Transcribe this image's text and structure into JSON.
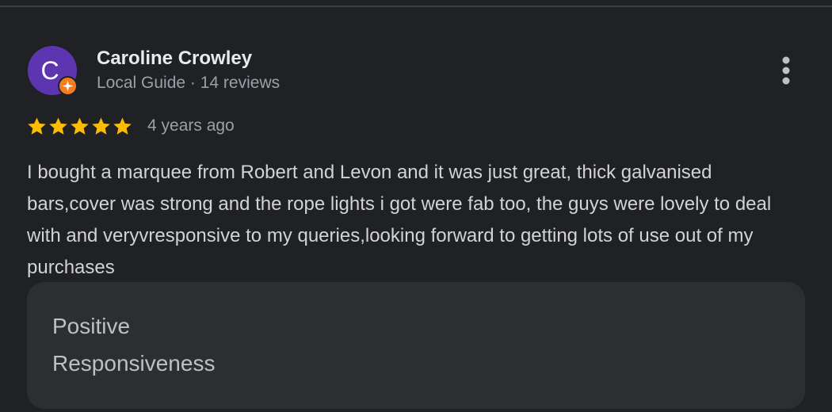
{
  "review": {
    "author": {
      "name": "Caroline Crowley",
      "initial": "C",
      "meta": "Local Guide · 14 reviews",
      "avatar_color": "#5e35b1",
      "badge_color": "#f57c1f",
      "badge_icon": "local-guide-star-icon"
    },
    "rating": {
      "stars": 5,
      "max": 5,
      "star_color": "#fbbc04"
    },
    "date": "4 years ago",
    "text": "I bought a marquee from Robert and Levon and it was just great, thick galvanised bars,cover was strong and the rope lights i got were fab too, the guys were lovely to deal with and veryvresponsive to my queries,looking forward to getting lots of use out of my purchases",
    "highlights": {
      "heading": "Positive",
      "value": "Responsiveness"
    },
    "menu_icon": "more-vert-icon"
  },
  "theme": {
    "background": "#202124",
    "card": "#2d2e30"
  }
}
